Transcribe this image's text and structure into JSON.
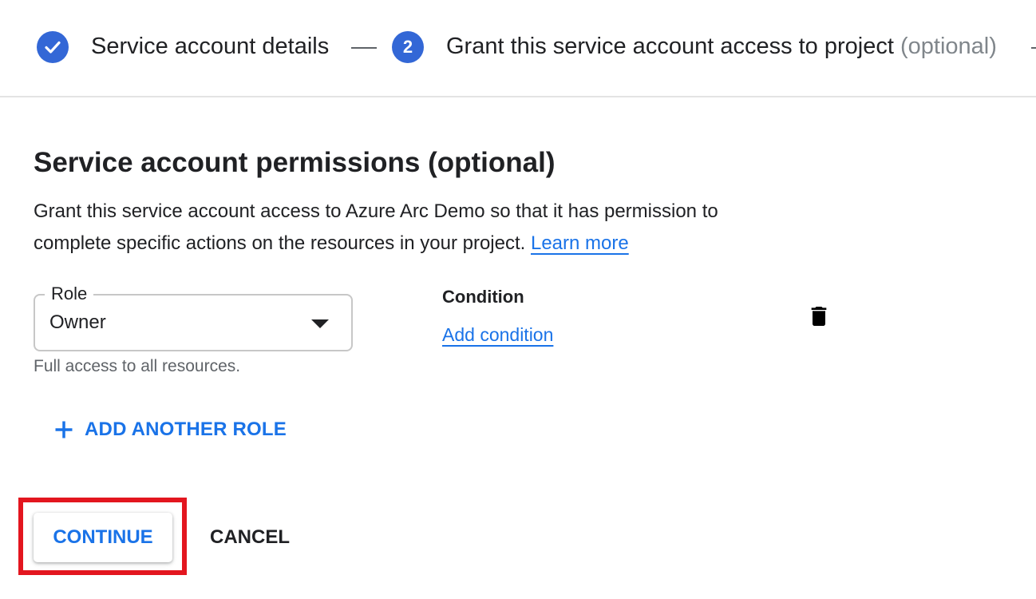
{
  "stepper": {
    "step1": {
      "label": "Service account details",
      "icon": "check-icon"
    },
    "step2": {
      "number": "2",
      "label": "Grant this service account access to project",
      "optional": "(optional)"
    }
  },
  "section": {
    "title": "Service account permissions (optional)",
    "description": "Grant this service account access to Azure Arc Demo so that it has permission to complete specific actions on the resources in your project.",
    "learn_more": "Learn more"
  },
  "role": {
    "label": "Role",
    "value": "Owner",
    "hint": "Full access to all resources."
  },
  "condition": {
    "label": "Condition",
    "add_link": "Add condition"
  },
  "actions": {
    "add_role": "ADD ANOTHER ROLE",
    "continue": "CONTINUE",
    "cancel": "CANCEL"
  },
  "colors": {
    "accent": "#1a73e8",
    "step_icon": "#3367d6",
    "highlight": "#e3161f"
  }
}
